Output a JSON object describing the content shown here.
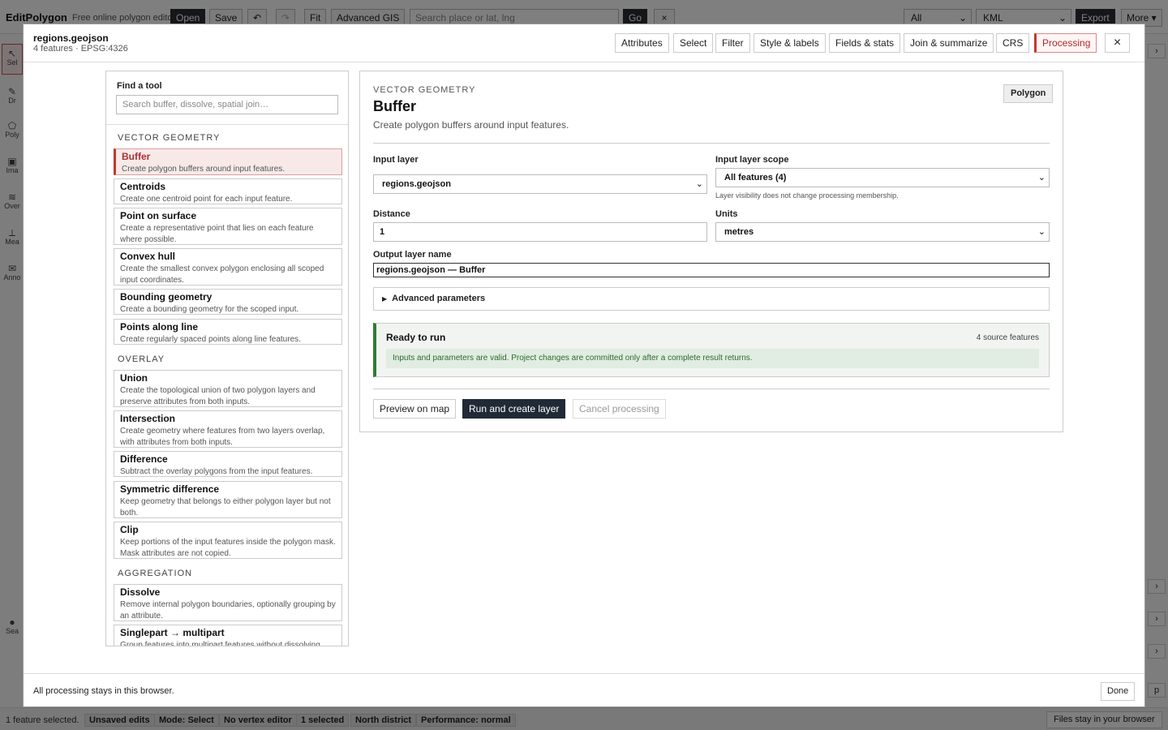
{
  "app": {
    "brand": "EditPolygon",
    "tagline": "Free online polygon editor",
    "buttons": {
      "open": "Open",
      "save": "Save",
      "undo": "↶",
      "redo": "↷",
      "fit": "Fit",
      "advanced_gis": "Advanced GIS",
      "go": "Go",
      "clear": "×",
      "export": "Export",
      "more": "More ▾"
    },
    "search_placeholder": "Search place or lat, lng",
    "filter_select": "All",
    "format_select": "KML",
    "left_rail": [
      "Sel",
      "Dr",
      "Poly",
      "Ima",
      "Over",
      "Mea",
      "Anno",
      "Sea"
    ],
    "right_rail": [
      "›",
      "›",
      "›",
      "›",
      "p"
    ],
    "status": {
      "text": "1 feature selected.",
      "chips": [
        "Unsaved edits",
        "Mode: Select",
        "No vertex editor",
        "1 selected",
        "North district",
        "Performance: normal"
      ],
      "right": "Files stay in your browser"
    }
  },
  "modal": {
    "title": "regions.geojson",
    "subtitle": "4 features · EPSG:4326",
    "tabs": [
      "Attributes",
      "Select",
      "Filter",
      "Style & labels",
      "Fields & stats",
      "Join & summarize",
      "CRS",
      "Processing"
    ],
    "close_label": "×",
    "find": {
      "label": "Find a tool",
      "placeholder": "Search buffer, dissolve, spatial join…"
    },
    "groups": [
      {
        "name": "VECTOR GEOMETRY",
        "tools": [
          {
            "name": "Buffer",
            "desc": "Create polygon buffers around input features."
          },
          {
            "name": "Centroids",
            "desc": "Create one centroid point for each input feature."
          },
          {
            "name": "Point on surface",
            "desc": "Create a representative point that lies on each feature where possible."
          },
          {
            "name": "Convex hull",
            "desc": "Create the smallest convex polygon enclosing all scoped input coordinates."
          },
          {
            "name": "Bounding geometry",
            "desc": "Create a bounding geometry for the scoped input."
          },
          {
            "name": "Points along line",
            "desc": "Create regularly spaced points along line features."
          }
        ]
      },
      {
        "name": "OVERLAY",
        "tools": [
          {
            "name": "Union",
            "desc": "Create the topological union of two polygon layers and preserve attributes from both inputs."
          },
          {
            "name": "Intersection",
            "desc": "Create geometry where features from two layers overlap, with attributes from both inputs."
          },
          {
            "name": "Difference",
            "desc": "Subtract the overlay polygons from the input features."
          },
          {
            "name": "Symmetric difference",
            "desc": "Keep geometry that belongs to either polygon layer but not both."
          },
          {
            "name": "Clip",
            "desc": "Keep portions of the input features inside the polygon mask. Mask attributes are not copied."
          }
        ]
      },
      {
        "name": "AGGREGATION",
        "tools": [
          {
            "name": "Dissolve",
            "desc": "Remove internal polygon boundaries, optionally grouping by an attribute."
          },
          {
            "name": "Singlepart → multipart",
            "desc": "Group features into multipart features without dissolving."
          }
        ]
      }
    ],
    "detail": {
      "category": "VECTOR GEOMETRY",
      "title": "Buffer",
      "description": "Create polygon buffers around input features.",
      "badge": "Polygon",
      "input_layer": {
        "label": "Input layer",
        "value": "regions.geojson"
      },
      "scope": {
        "label": "Input layer scope",
        "value": "All features (4)",
        "note": "Layer visibility does not change processing membership."
      },
      "distance": {
        "label": "Distance",
        "value": "1"
      },
      "units": {
        "label": "Units",
        "value": "metres"
      },
      "output": {
        "label": "Output layer name",
        "value": "regions.geojson — Buffer"
      },
      "advanced": "Advanced parameters",
      "ready": {
        "title": "Ready to run",
        "count": "4 source features",
        "message": "Inputs and parameters are valid. Project changes are committed only after a complete result returns."
      },
      "actions": {
        "preview": "Preview on map",
        "run": "Run and create layer",
        "cancel": "Cancel processing"
      }
    },
    "footer": {
      "text": "All processing stays in this browser.",
      "done": "Done"
    }
  }
}
